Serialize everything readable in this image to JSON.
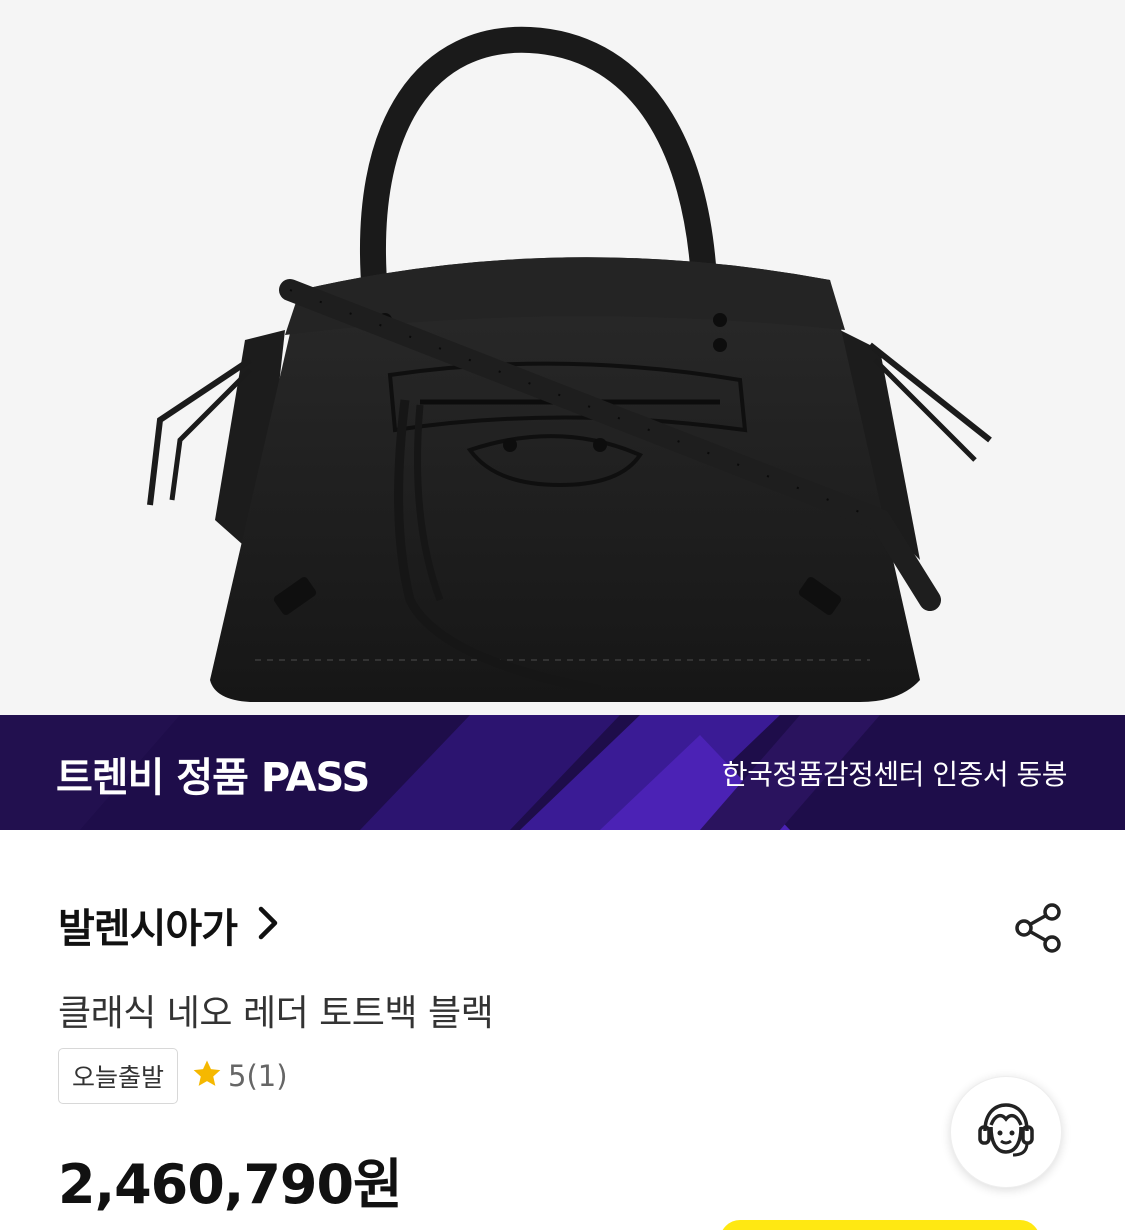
{
  "banner": {
    "title": "트렌비 정품 PASS",
    "subtitle": "한국정품감정센터 인증서 동봉"
  },
  "product": {
    "brand": "발렌시아가",
    "name": "클래식 네오 레더 토트백 블랙",
    "shipping_tag": "오늘출발",
    "rating": "5(1)",
    "price": "2,460,790원"
  },
  "colors": {
    "banner_background": "#1e0d4a",
    "banner_accent": "#4b22b5",
    "star": "#f5b800",
    "cta_yellow": "#ffe812"
  },
  "icons": {
    "brand_link": "chevron-right-icon",
    "share": "share-icon",
    "rating": "star-icon",
    "customer_service": "headset-agent-icon"
  }
}
